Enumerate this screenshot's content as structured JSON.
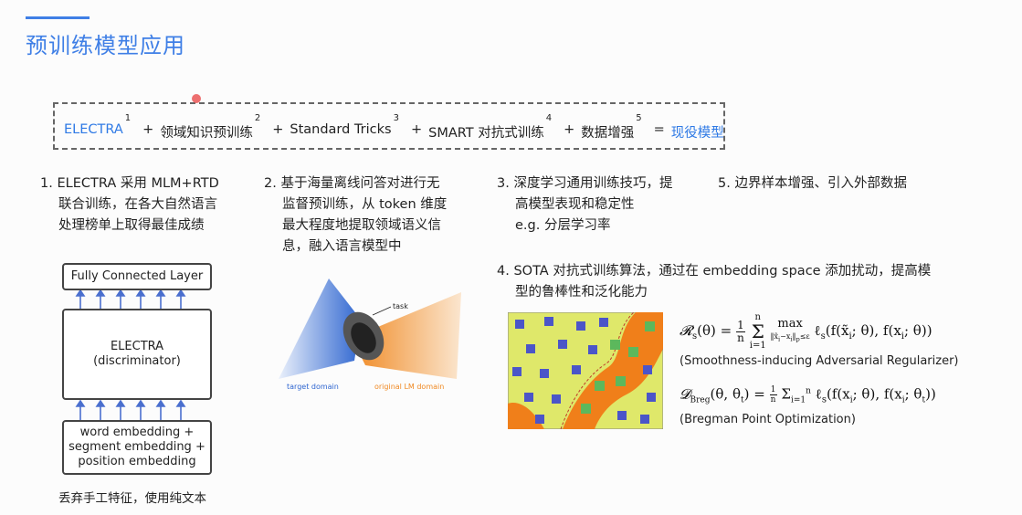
{
  "slide": {
    "title": "预训练模型应用"
  },
  "formula": {
    "items": [
      {
        "text": "ELECTRA",
        "sup": "1",
        "highlight": true
      },
      {
        "text": "领域知识预训练",
        "sup": "2",
        "highlight": false
      },
      {
        "text": "Standard Tricks",
        "sup": "3",
        "highlight": false
      },
      {
        "text": "SMART 对抗式训练",
        "sup": "4",
        "highlight": false
      },
      {
        "text": "数据增强",
        "sup": "5",
        "highlight": false
      }
    ],
    "plus": "+",
    "equals": "=",
    "result": "现役模型"
  },
  "points": {
    "p1": {
      "num": "1.",
      "lines": [
        "ELECTRA 采用 MLM+RTD",
        "联合训练，在各大自然语言",
        "处理榜单上取得最佳成绩"
      ]
    },
    "p2": {
      "num": "2.",
      "lines": [
        "基于海量离线问答对进行无",
        "监督预训练，从 token 维度",
        "最大程度地提取领域语义信",
        "息，融入语言模型中"
      ]
    },
    "p3": {
      "num": "3.",
      "lines": [
        "深度学习通用训练技巧，提",
        "高模型表现和稳定性",
        "e.g. 分层学习率"
      ]
    },
    "p4": {
      "num": "4.",
      "lines": [
        "SOTA 对抗式训练算法，通过在 embedding space 添加扰动，提高模",
        "型的鲁棒性和泛化能力"
      ]
    },
    "p5": {
      "num": "5.",
      "lines": [
        "边界样本增强、引入外部数据"
      ]
    }
  },
  "electra_diagram": {
    "top_label": "Fully Connected Layer",
    "middle_line1": "ELECTRA",
    "middle_line2": "(discriminator)",
    "bottom_line1": "word embedding +",
    "bottom_line2": "segment embedding +",
    "bottom_line3": "position embedding",
    "caption": "丢弃手工特征，使用纯文本",
    "border_color": "#444444",
    "arrow_color": "#4a6fcf"
  },
  "domain_figure": {
    "task_label": "task",
    "target_label": "target domain",
    "original_label": "original LM domain",
    "target_color": "#2f66d0",
    "original_color": "#f08a24"
  },
  "smart": {
    "formula1": "R_s(θ) = (1/n) Σ_{i=1}^{n} max_{‖x̃_i − x_i‖_p ≤ ε} ℓ_s(f(x̃_i; θ), f(x_i; θ))",
    "caption1": "(Smoothness-inducing Adversarial Regularizer)",
    "formula2": "D_Breg(θ, θ_t) = (1/n) Σ_{i=1}^{n} ℓ_s(f(x_i; θ), f(x_i; θ_t))",
    "caption2": "(Bregman Point Optimization)",
    "plot_bg": "#dfe86a",
    "plot_orange": "#f07f1a",
    "marker_blue": "#4b55c8",
    "marker_green": "#5cb85c"
  }
}
